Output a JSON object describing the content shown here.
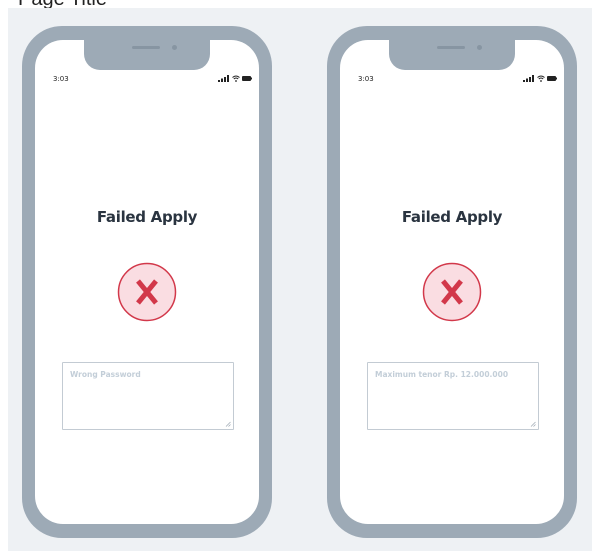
{
  "header": {
    "label": "Page Title"
  },
  "colors": {
    "phone_frame": "#9daab6",
    "background": "#eef1f4",
    "error_red": "#d2384a",
    "error_fill": "#fadde2"
  },
  "phones": [
    {
      "status_time": "3:03",
      "title": "Failed Apply",
      "icon": "close-x-icon",
      "message": "Wrong Password"
    },
    {
      "status_time": "3:03",
      "title": "Failed Apply",
      "icon": "close-x-icon",
      "message": "Maximum tenor Rp. 12.000.000"
    }
  ]
}
